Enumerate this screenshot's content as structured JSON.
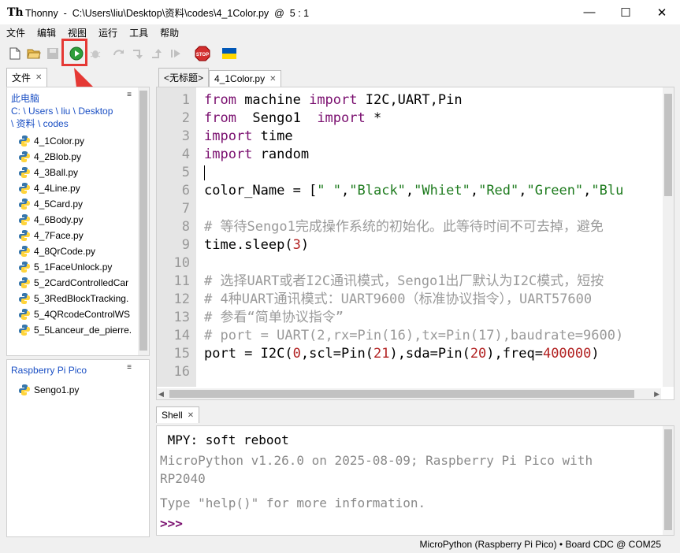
{
  "window": {
    "app_name": "Thonny",
    "path": "C:\\Users\\liu\\Desktop\\资料\\codes\\4_1Color.py",
    "separator": "@",
    "position": "5 : 1"
  },
  "menu": [
    "文件",
    "编辑",
    "视图",
    "运行",
    "工具",
    "帮助"
  ],
  "toolbar": {
    "buttons": [
      "new-file",
      "open-file",
      "save-file",
      "run",
      "debug",
      "step-over",
      "step-into",
      "step-out",
      "resume",
      "stop",
      "ukraine-flag"
    ],
    "stop_label": "STOP"
  },
  "files": {
    "tab": "文件",
    "menu_glyph": "≡",
    "this_pc": "此电脑",
    "path_line1": "C: \\ Users \\ liu \\ Desktop",
    "path_line2": "\\ 资料 \\ codes",
    "items": [
      "4_1Color.py",
      "4_2Blob.py",
      "4_3Ball.py",
      "4_4Line.py",
      "4_5Card.py",
      "4_6Body.py",
      "4_7Face.py",
      "4_8QrCode.py",
      "5_1FaceUnlock.py",
      "5_2CardControlledCar",
      "5_3RedBlockTracking.",
      "5_4QRcodeControlWS",
      "5_5Lanceur_de_pierre."
    ]
  },
  "device": {
    "title": "Raspberry Pi Pico",
    "menu_glyph": "≡",
    "items": [
      "Sengo1.py"
    ]
  },
  "editor": {
    "tabs": [
      "<无标题>",
      "4_1Color.py"
    ],
    "active_tab": 1,
    "lines": [
      {
        "n": "1",
        "parts": [
          {
            "t": "from",
            "c": "kw"
          },
          {
            "t": " machine ",
            "c": ""
          },
          {
            "t": "import",
            "c": "kw"
          },
          {
            "t": " I2C,UART,Pin",
            "c": ""
          }
        ]
      },
      {
        "n": "2",
        "parts": [
          {
            "t": "from",
            "c": "kw"
          },
          {
            "t": "  Sengo1  ",
            "c": ""
          },
          {
            "t": "import",
            "c": "kw"
          },
          {
            "t": " *",
            "c": ""
          }
        ]
      },
      {
        "n": "3",
        "parts": [
          {
            "t": "import",
            "c": "kw"
          },
          {
            "t": " time",
            "c": ""
          }
        ]
      },
      {
        "n": "4",
        "parts": [
          {
            "t": "import",
            "c": "kw"
          },
          {
            "t": " random",
            "c": ""
          }
        ]
      },
      {
        "n": "5",
        "parts": []
      },
      {
        "n": "6",
        "parts": [
          {
            "t": "color_Name = [",
            "c": ""
          },
          {
            "t": "\" \"",
            "c": "str"
          },
          {
            "t": ",",
            "c": ""
          },
          {
            "t": "\"Black\"",
            "c": "str"
          },
          {
            "t": ",",
            "c": ""
          },
          {
            "t": "\"Whiet\"",
            "c": "str"
          },
          {
            "t": ",",
            "c": ""
          },
          {
            "t": "\"Red\"",
            "c": "str"
          },
          {
            "t": ",",
            "c": ""
          },
          {
            "t": "\"Green\"",
            "c": "str"
          },
          {
            "t": ",",
            "c": ""
          },
          {
            "t": "\"Blu",
            "c": "str"
          }
        ]
      },
      {
        "n": "7",
        "parts": []
      },
      {
        "n": "8",
        "parts": [
          {
            "t": "# 等待Sengo1完成操作系统的初始化。此等待时间不可去掉，避免",
            "c": "cmt"
          }
        ]
      },
      {
        "n": "9",
        "parts": [
          {
            "t": "time.sleep(",
            "c": ""
          },
          {
            "t": "3",
            "c": "num"
          },
          {
            "t": ")",
            "c": ""
          }
        ]
      },
      {
        "n": "10",
        "parts": []
      },
      {
        "n": "11",
        "parts": [
          {
            "t": "# 选择UART或者I2C通讯模式，Sengo1出厂默认为I2C模式，短按",
            "c": "cmt"
          }
        ]
      },
      {
        "n": "12",
        "parts": [
          {
            "t": "# 4种UART通讯模式：UART9600（标准协议指令），UART57600",
            "c": "cmt"
          }
        ]
      },
      {
        "n": "13",
        "parts": [
          {
            "t": "# 参看“简单协议指令”",
            "c": "cmt"
          }
        ]
      },
      {
        "n": "14",
        "parts": [
          {
            "t": "# port = UART(2,rx=Pin(16),tx=Pin(17),baudrate=9600)",
            "c": "cmt"
          }
        ]
      },
      {
        "n": "15",
        "parts": [
          {
            "t": "port = I2C(",
            "c": ""
          },
          {
            "t": "0",
            "c": "num"
          },
          {
            "t": ",scl=Pin(",
            "c": ""
          },
          {
            "t": "21",
            "c": "num"
          },
          {
            "t": "),sda=Pin(",
            "c": ""
          },
          {
            "t": "20",
            "c": "num"
          },
          {
            "t": "),freq=",
            "c": ""
          },
          {
            "t": "400000",
            "c": "num"
          },
          {
            "t": ")",
            "c": ""
          }
        ]
      },
      {
        "n": "16",
        "parts": []
      }
    ]
  },
  "shell": {
    "tab": "Shell",
    "line1": " MPY: soft reboot",
    "line2": "MicroPython v1.26.0 on 2025-08-09; Raspberry Pi Pico with",
    "line3": "RP2040",
    "line4": "Type \"help()\" for more information.",
    "prompt": ">>>"
  },
  "status": "MicroPython (Raspberry Pi Pico)  •  Board CDC @ COM25",
  "colors": {
    "keyword": "#7a0f6f",
    "number": "#b22222",
    "string": "#1e7b1e",
    "comment": "#9a9a9a",
    "highlight": "#e53935"
  }
}
